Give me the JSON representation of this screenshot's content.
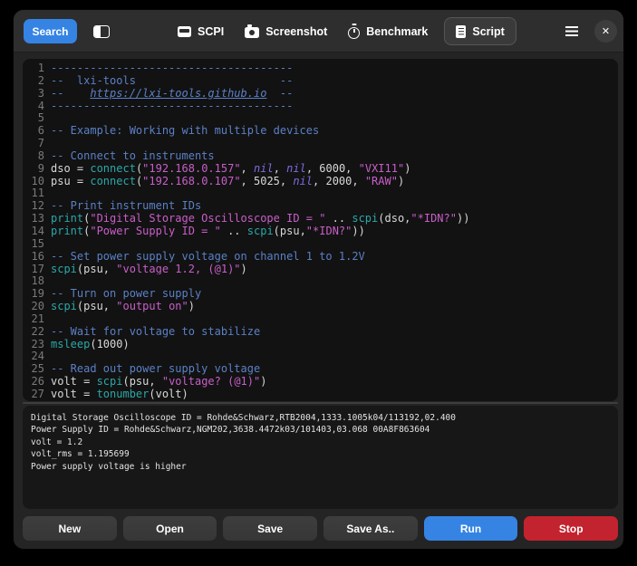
{
  "colors": {
    "accent": "#3584e4",
    "destructive": "#c3232f",
    "headerbar": "#2e2e2e",
    "window": "#242424",
    "editorbg": "#121212",
    "consolebg": "#171717",
    "comment": "#5b80c6",
    "string": "#c95fc9",
    "function": "#2ba8a8",
    "keyword": "#7e6bdf",
    "plain": "#d8d8d8",
    "linenum": "#7a7a7a",
    "consoletext": "#e4e4e4"
  },
  "header": {
    "search_label": "Search",
    "sidebar_toggle_icon": "sidebar-toggle-icon",
    "menu_icon": "menu-icon",
    "close_icon": "close-icon",
    "close_glyph": "✕",
    "tabs": [
      {
        "id": "scpi",
        "label": "SCPI",
        "icon": "instrument-icon",
        "active": false
      },
      {
        "id": "screenshot",
        "label": "Screenshot",
        "icon": "camera-icon",
        "active": false
      },
      {
        "id": "benchmark",
        "label": "Benchmark",
        "icon": "stopwatch-icon",
        "active": false
      },
      {
        "id": "script",
        "label": "Script",
        "icon": "document-icon",
        "active": true
      }
    ]
  },
  "editor": {
    "lines": [
      {
        "n": 1,
        "s": [
          [
            "cm",
            "-------------------------------------"
          ]
        ]
      },
      {
        "n": 2,
        "s": [
          [
            "cm",
            "--  lxi-tools                      --"
          ]
        ]
      },
      {
        "n": 3,
        "s": [
          [
            "cm",
            "--    "
          ],
          [
            "lk",
            "https://lxi-tools.github.io"
          ],
          [
            "cm",
            "  --"
          ]
        ]
      },
      {
        "n": 4,
        "s": [
          [
            "cm",
            "-------------------------------------"
          ]
        ]
      },
      {
        "n": 5,
        "s": []
      },
      {
        "n": 6,
        "s": [
          [
            "cm",
            "-- Example: Working with multiple devices"
          ]
        ]
      },
      {
        "n": 7,
        "s": []
      },
      {
        "n": 8,
        "s": [
          [
            "cm",
            "-- Connect to instruments"
          ]
        ]
      },
      {
        "n": 9,
        "s": [
          [
            "pl",
            "dso = "
          ],
          [
            "fn",
            "connect"
          ],
          [
            "pl",
            "("
          ],
          [
            "st",
            "\"192.168.0.157\""
          ],
          [
            "pl",
            ", "
          ],
          [
            "kw",
            "nil"
          ],
          [
            "pl",
            ", "
          ],
          [
            "kw",
            "nil"
          ],
          [
            "pl",
            ", 6000, "
          ],
          [
            "st",
            "\"VXI11\""
          ],
          [
            "pl",
            ")"
          ]
        ]
      },
      {
        "n": 10,
        "s": [
          [
            "pl",
            "psu = "
          ],
          [
            "fn",
            "connect"
          ],
          [
            "pl",
            "("
          ],
          [
            "st",
            "\"192.168.0.107\""
          ],
          [
            "pl",
            ", 5025, "
          ],
          [
            "kw",
            "nil"
          ],
          [
            "pl",
            ", 2000, "
          ],
          [
            "st",
            "\"RAW\""
          ],
          [
            "pl",
            ")"
          ]
        ]
      },
      {
        "n": 11,
        "s": []
      },
      {
        "n": 12,
        "s": [
          [
            "cm",
            "-- Print instrument IDs"
          ]
        ]
      },
      {
        "n": 13,
        "s": [
          [
            "fn",
            "print"
          ],
          [
            "pl",
            "("
          ],
          [
            "st",
            "\"Digital Storage Oscilloscope ID = \""
          ],
          [
            "pl",
            " .. "
          ],
          [
            "fn",
            "scpi"
          ],
          [
            "pl",
            "(dso,"
          ],
          [
            "st",
            "\"*IDN?\""
          ],
          [
            "pl",
            "))"
          ]
        ]
      },
      {
        "n": 14,
        "s": [
          [
            "fn",
            "print"
          ],
          [
            "pl",
            "("
          ],
          [
            "st",
            "\"Power Supply ID = \""
          ],
          [
            "pl",
            " .. "
          ],
          [
            "fn",
            "scpi"
          ],
          [
            "pl",
            "(psu,"
          ],
          [
            "st",
            "\"*IDN?\""
          ],
          [
            "pl",
            "))"
          ]
        ]
      },
      {
        "n": 15,
        "s": []
      },
      {
        "n": 16,
        "s": [
          [
            "cm",
            "-- Set power supply voltage on channel 1 to 1.2V"
          ]
        ]
      },
      {
        "n": 17,
        "s": [
          [
            "fn",
            "scpi"
          ],
          [
            "pl",
            "(psu, "
          ],
          [
            "st",
            "\"voltage 1.2, (@1)\""
          ],
          [
            "pl",
            ")"
          ]
        ]
      },
      {
        "n": 18,
        "s": []
      },
      {
        "n": 19,
        "s": [
          [
            "cm",
            "-- Turn on power supply"
          ]
        ]
      },
      {
        "n": 20,
        "s": [
          [
            "fn",
            "scpi"
          ],
          [
            "pl",
            "(psu, "
          ],
          [
            "st",
            "\"output on\""
          ],
          [
            "pl",
            ")"
          ]
        ]
      },
      {
        "n": 21,
        "s": []
      },
      {
        "n": 22,
        "s": [
          [
            "cm",
            "-- Wait for voltage to stabilize"
          ]
        ]
      },
      {
        "n": 23,
        "s": [
          [
            "fn",
            "msleep"
          ],
          [
            "pl",
            "(1000)"
          ]
        ]
      },
      {
        "n": 24,
        "s": []
      },
      {
        "n": 25,
        "s": [
          [
            "cm",
            "-- Read out power supply voltage"
          ]
        ]
      },
      {
        "n": 26,
        "s": [
          [
            "pl",
            "volt = "
          ],
          [
            "fn",
            "scpi"
          ],
          [
            "pl",
            "(psu, "
          ],
          [
            "st",
            "\"voltage? (@1)\""
          ],
          [
            "pl",
            ")"
          ]
        ]
      },
      {
        "n": 27,
        "s": [
          [
            "pl",
            "volt = "
          ],
          [
            "fn",
            "tonumber"
          ],
          [
            "pl",
            "(volt)"
          ]
        ]
      }
    ]
  },
  "console": {
    "lines": [
      "Digital Storage Oscilloscope ID = Rohde&Schwarz,RTB2004,1333.1005k04/113192,02.400",
      "Power Supply ID = Rohde&Schwarz,NGM202,3638.4472k03/101403,03.068 00A8F863604",
      "volt = 1.2",
      "volt_rms = 1.195699",
      "Power supply voltage is higher"
    ]
  },
  "actions": [
    {
      "id": "new",
      "label": "New",
      "style": "default"
    },
    {
      "id": "open",
      "label": "Open",
      "style": "default"
    },
    {
      "id": "save",
      "label": "Save",
      "style": "default"
    },
    {
      "id": "save-as",
      "label": "Save As..",
      "style": "default"
    },
    {
      "id": "run",
      "label": "Run",
      "style": "suggested"
    },
    {
      "id": "stop",
      "label": "Stop",
      "style": "destructive"
    }
  ]
}
